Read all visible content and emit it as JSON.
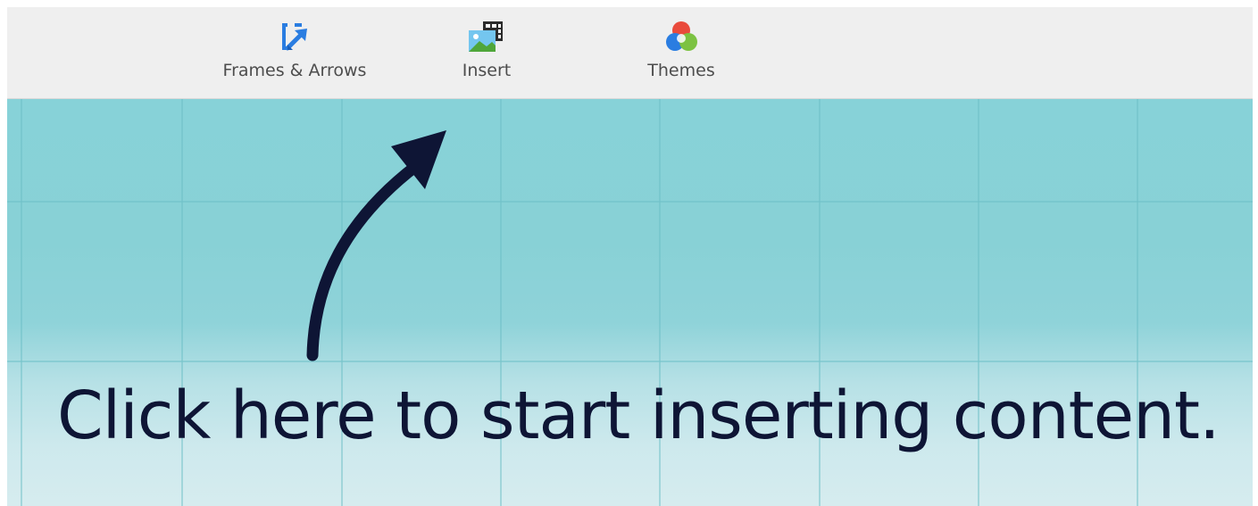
{
  "toolbar": {
    "items": [
      {
        "label": "Frames & Arrows",
        "icon": "frames-arrows-icon"
      },
      {
        "label": "Insert",
        "icon": "insert-image-icon"
      },
      {
        "label": "Themes",
        "icon": "themes-icon"
      }
    ]
  },
  "canvas": {
    "prompt_text": "Click here to start inserting content.",
    "background_color": "#87d2d8",
    "grid_color": "#6cbfc6",
    "text_color": "#0e1535"
  }
}
